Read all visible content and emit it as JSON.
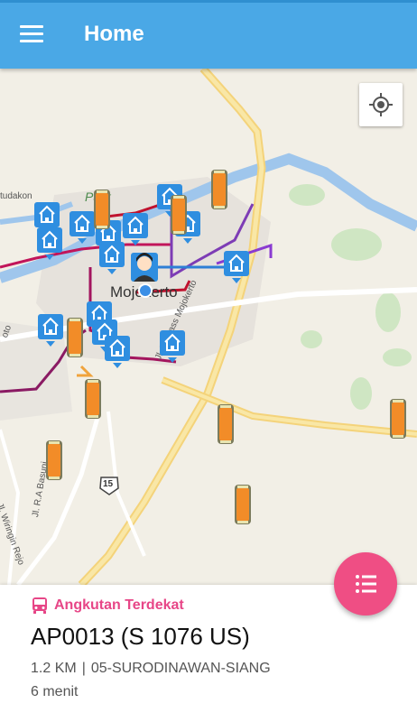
{
  "app_bar": {
    "title": "Home"
  },
  "map": {
    "city_label": "Mojokerto",
    "park_label": "Park",
    "road_labels": {
      "bypass": "Jl. By Pass Mojokerto",
      "wiringin": "Jl. Wiringin Rejo",
      "basuni": "Jl. R.A Basuni",
      "route_shield": "15",
      "left_edge": "tudakon",
      "left_edge2": "oto"
    }
  },
  "nearest": {
    "header": "Angkutan Terdekat",
    "vehicle": "AP0013 (S 1076 US)",
    "distance": "1.2 KM",
    "separator": "|",
    "route": "05-SURODINAWAN-SIANG",
    "eta": "6 menit"
  },
  "colors": {
    "app_bar": "#4aa8e6",
    "accent": "#ef4e84",
    "header_text": "#e74687",
    "house_marker": "#2f8ee0",
    "bus_body": "#f28c28"
  },
  "icons": {
    "menu": "hamburger-icon",
    "locate": "my-location-icon",
    "fab": "list-icon",
    "bus": "bus-icon",
    "house": "house-marker-icon",
    "user": "user-location-icon"
  }
}
